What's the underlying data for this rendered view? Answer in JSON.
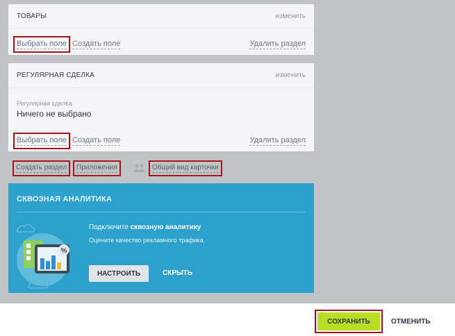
{
  "sections": [
    {
      "title": "ТОВАРЫ",
      "edit_label": "изменить",
      "select_field": "Выбрать поле",
      "create_field": "Создать поле",
      "delete_section": "Удалить раздел"
    },
    {
      "title": "РЕГУЛЯРНАЯ СДЕЛКА",
      "edit_label": "изменить",
      "field_label": "Регулярная сделка",
      "field_value": "Ничего не выбрано",
      "select_field": "Выбрать поле",
      "create_field": "Создать поле",
      "delete_section": "Удалить раздел"
    }
  ],
  "under_links": {
    "create_section": "Создать раздел",
    "applications": "Приложения",
    "people_icon": "people-icon",
    "card_view": "Общий вид карточки"
  },
  "promo": {
    "title": "СКВОЗНАЯ АНАЛИТИКА",
    "text_prefix": "Подключите",
    "text_bold": "сквозную аналитику",
    "subtext": "Оцените качество рекламного трафика.",
    "setup_button": "НАСТРОИТЬ",
    "hide_button": "СКРЫТЬ",
    "illustration_icon": "analytics-chart-icon"
  },
  "footer": {
    "save_button": "СОХРАНИТЬ",
    "cancel_button": "ОТМЕНИТЬ"
  },
  "colors": {
    "background": "#c1c4c5",
    "panel": "#f5f5f7",
    "promo": "#2da0cb",
    "save": "#b8df24",
    "highlight": "#a8141e"
  }
}
